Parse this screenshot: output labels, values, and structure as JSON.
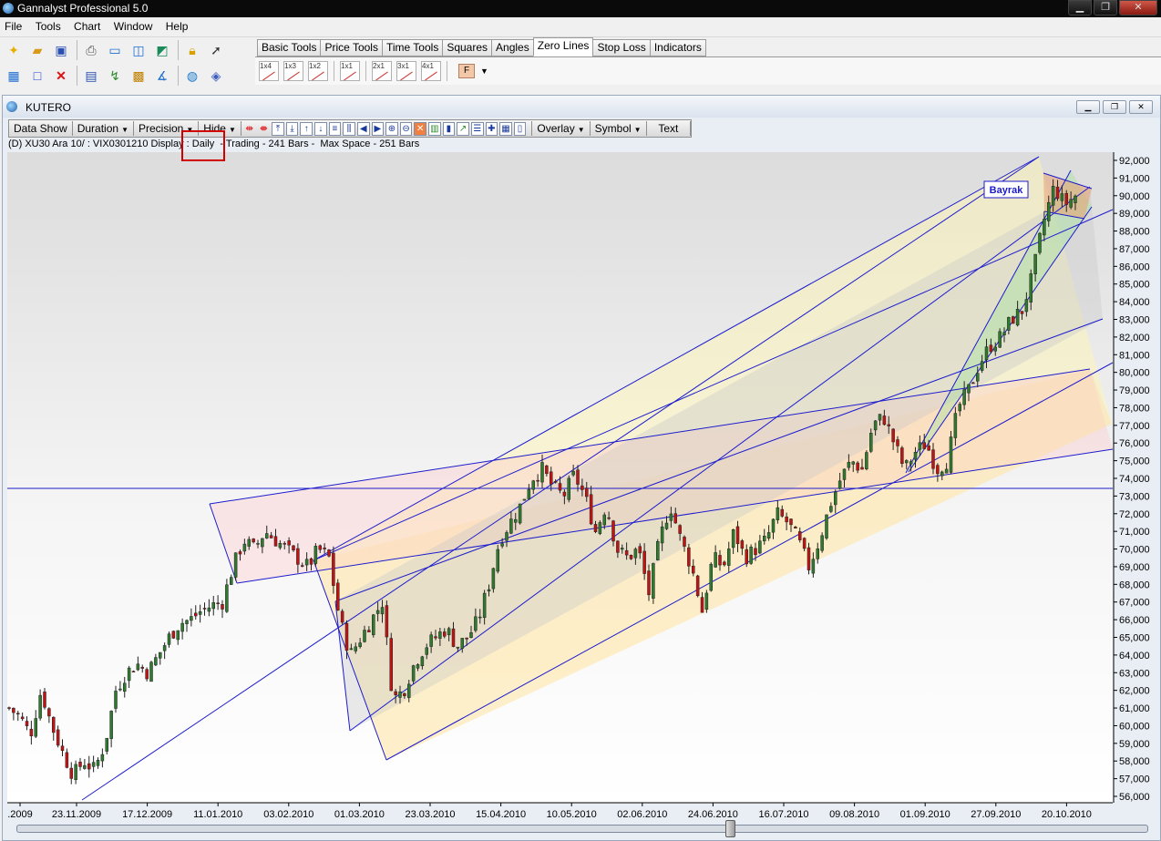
{
  "app": {
    "title": "Gannalyst Professional 5.0"
  },
  "menu": [
    "File",
    "Tools",
    "Chart",
    "Window",
    "Help"
  ],
  "tabs": {
    "items": [
      "Basic Tools",
      "Price Tools",
      "Time Tools",
      "Squares",
      "Angles",
      "Zero Lines",
      "Stop Loss",
      "Indicators"
    ],
    "active": "Zero Lines",
    "zero_line_buttons": [
      "1x4",
      "1x3",
      "1x2",
      "1x1",
      "2x1",
      "3x1",
      "4x1"
    ],
    "f_button": "F"
  },
  "document": {
    "title": "KUTERO"
  },
  "chart_toolbar": {
    "data_show": "Data Show",
    "duration": "Duration",
    "precision": "Precision",
    "hide": "Hide",
    "overlay": "Overlay",
    "symbol": "Symbol",
    "text": "Text"
  },
  "info": {
    "prefix": "(D) XU30 Ara 10/ : VIX0301210 Display :",
    "period": "Daily",
    "suffix": "- Trading - 241 Bars -  Max Space - 251 Bars"
  },
  "annotation": {
    "label": "Bayrak"
  },
  "colors": {
    "line_blue": "#1c1ccd",
    "candle_up": "#2f7a2f",
    "candle_down": "#c01414",
    "highlight_red": "#d00000"
  },
  "chart_data": {
    "type": "candlestick",
    "y_axis": {
      "ticks": [
        56000,
        57000,
        58000,
        59000,
        60000,
        61000,
        62000,
        63000,
        64000,
        65000,
        66000,
        67000,
        68000,
        69000,
        70000,
        71000,
        72000,
        73000,
        74000,
        75000,
        76000,
        77000,
        78000,
        79000,
        80000,
        81000,
        82000,
        83000,
        84000,
        85000,
        86000,
        87000,
        88000,
        89000,
        90000,
        91000,
        92000
      ]
    },
    "x_axis": {
      "ticks": [
        ".2009",
        "23.11.2009",
        "17.12.2009",
        "11.01.2010",
        "03.02.2010",
        "01.03.2010",
        "23.03.2010",
        "15.04.2010",
        "10.05.2010",
        "02.06.2010",
        "24.06.2010",
        "16.07.2010",
        "09.08.2010",
        "01.09.2010",
        "27.09.2010",
        "20.10.2010"
      ]
    },
    "horizontal_line": 73500,
    "series": [
      {
        "close_path": [
          [
            0,
            61000
          ],
          [
            5,
            60500
          ],
          [
            10,
            59500
          ],
          [
            15,
            62000
          ],
          [
            20,
            60000
          ],
          [
            25,
            58500
          ],
          [
            30,
            57200
          ],
          [
            35,
            58000
          ],
          [
            40,
            57500
          ],
          [
            45,
            59000
          ],
          [
            50,
            62000
          ],
          [
            55,
            63000
          ],
          [
            60,
            63500
          ],
          [
            65,
            63000
          ],
          [
            70,
            64000
          ],
          [
            75,
            65000
          ],
          [
            80,
            65800
          ],
          [
            85,
            66000
          ],
          [
            90,
            66500
          ],
          [
            95,
            66800
          ],
          [
            100,
            67000
          ],
          [
            105,
            69000
          ],
          [
            110,
            70500
          ],
          [
            115,
            70000
          ],
          [
            120,
            71000
          ],
          [
            125,
            70500
          ],
          [
            130,
            70000
          ],
          [
            135,
            69500
          ],
          [
            140,
            69000
          ],
          [
            145,
            70000
          ],
          [
            150,
            69500
          ],
          [
            155,
            66000
          ],
          [
            160,
            64000
          ],
          [
            165,
            65000
          ],
          [
            170,
            66000
          ],
          [
            175,
            67000
          ],
          [
            180,
            61500
          ],
          [
            185,
            62000
          ],
          [
            190,
            63500
          ],
          [
            195,
            64500
          ],
          [
            200,
            65000
          ],
          [
            205,
            65500
          ],
          [
            210,
            64500
          ],
          [
            215,
            65000
          ],
          [
            220,
            66000
          ],
          [
            225,
            68000
          ],
          [
            230,
            70500
          ],
          [
            235,
            71500
          ],
          [
            240,
            72500
          ],
          [
            245,
            74000
          ],
          [
            250,
            74500
          ],
          [
            255,
            73500
          ],
          [
            260,
            73000
          ],
          [
            265,
            74200
          ],
          [
            270,
            73000
          ],
          [
            275,
            71000
          ],
          [
            280,
            72500
          ],
          [
            285,
            70000
          ],
          [
            290,
            69500
          ],
          [
            295,
            70000
          ],
          [
            300,
            67500
          ],
          [
            305,
            70500
          ],
          [
            310,
            72500
          ],
          [
            315,
            70500
          ],
          [
            320,
            69000
          ],
          [
            325,
            66500
          ],
          [
            330,
            69500
          ],
          [
            335,
            69000
          ],
          [
            340,
            71000
          ],
          [
            345,
            69500
          ],
          [
            350,
            70000
          ],
          [
            355,
            70500
          ],
          [
            360,
            72000
          ],
          [
            365,
            71500
          ],
          [
            370,
            70500
          ],
          [
            375,
            69000
          ],
          [
            380,
            70500
          ],
          [
            385,
            72500
          ],
          [
            390,
            74000
          ],
          [
            395,
            75000
          ],
          [
            400,
            74500
          ],
          [
            405,
            77000
          ],
          [
            410,
            77500
          ],
          [
            415,
            76000
          ],
          [
            420,
            74500
          ],
          [
            425,
            75500
          ],
          [
            430,
            76000
          ],
          [
            435,
            74500
          ],
          [
            440,
            75000
          ],
          [
            445,
            78000
          ],
          [
            450,
            79000
          ],
          [
            455,
            80500
          ],
          [
            460,
            81500
          ],
          [
            465,
            82000
          ],
          [
            470,
            83000
          ],
          [
            475,
            83500
          ],
          [
            480,
            85500
          ],
          [
            485,
            88500
          ],
          [
            490,
            90500
          ],
          [
            495,
            89500
          ],
          [
            500,
            90000
          ]
        ]
      }
    ],
    "ylim": [
      55800,
      92400
    ]
  }
}
